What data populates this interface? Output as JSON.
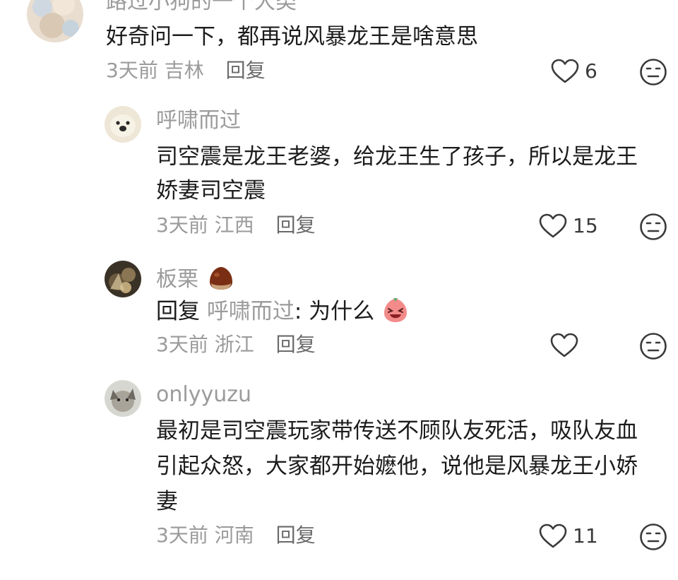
{
  "comments": [
    {
      "username": "路过小狗的一个大类",
      "text_lines": [
        "好奇问一下，都再说风暴龙王是啥意思"
      ],
      "time": "3天前",
      "location": "吉林",
      "reply_label": "回复",
      "likes": "6"
    },
    {
      "username": "呼啸而过",
      "text_lines": [
        "司空震是龙王老婆，给龙王生了孩子，所以是龙王",
        "娇妻司空震"
      ],
      "time": "3天前",
      "location": "江西",
      "reply_label": "回复",
      "likes": "15"
    },
    {
      "username": "板栗",
      "username_emoji": "chestnut-emoji",
      "reply_prefix": "回复",
      "reply_target": "呼啸而过",
      "reply_text": ": 为什么",
      "text_emoji": "laughing-peach-emoji",
      "time": "3天前",
      "location": "浙江",
      "reply_label": "回复",
      "likes": ""
    },
    {
      "username": "onlyyuzu",
      "text_lines": [
        "最初是司空震玩家带传送不顾队友死活，吸队友血",
        "引起众怒，大家都开始嬷他，说他是风暴龙王小娇",
        "妻"
      ],
      "time": "3天前",
      "location": "河南",
      "reply_label": "回复",
      "likes": "11"
    }
  ],
  "icons": {
    "like": "heart-outline-icon",
    "dislike": "neutral-face-icon"
  }
}
